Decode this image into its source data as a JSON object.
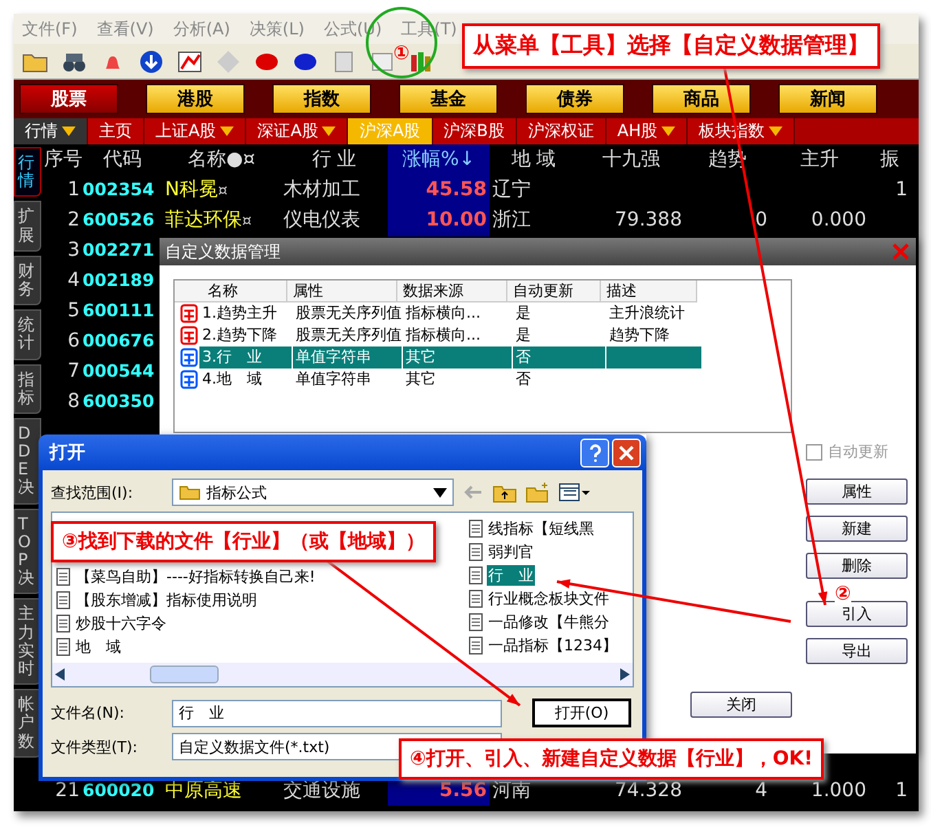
{
  "menu": [
    "文件(F)",
    "查看(V)",
    "分析(A)",
    "决策(L)",
    "公式(U)",
    "工具(T)"
  ],
  "categories": [
    {
      "label": "股票",
      "selected": true
    },
    {
      "label": "港股",
      "selected": false
    },
    {
      "label": "指数",
      "selected": false
    },
    {
      "label": "基金",
      "selected": false
    },
    {
      "label": "债券",
      "selected": false
    },
    {
      "label": "商品",
      "selected": false
    },
    {
      "label": "新闻",
      "selected": false
    }
  ],
  "tabs": [
    {
      "label": "行情",
      "kind": "menu",
      "selected": false,
      "dropdown": true
    },
    {
      "label": "主页",
      "kind": "tab",
      "selected": false,
      "dropdown": false
    },
    {
      "label": "上证A股",
      "kind": "tab",
      "selected": false,
      "dropdown": true
    },
    {
      "label": "深证A股",
      "kind": "tab",
      "selected": false,
      "dropdown": true
    },
    {
      "label": "沪深A股",
      "kind": "tab",
      "selected": true,
      "dropdown": false
    },
    {
      "label": "沪深B股",
      "kind": "tab",
      "selected": false,
      "dropdown": false
    },
    {
      "label": "沪深权证",
      "kind": "tab",
      "selected": false,
      "dropdown": false
    },
    {
      "label": "AH股",
      "kind": "tab",
      "selected": false,
      "dropdown": true
    },
    {
      "label": "板块指数",
      "kind": "tab",
      "selected": false,
      "dropdown": true
    }
  ],
  "side_tabs": [
    {
      "label": "行情",
      "selected": true
    },
    {
      "label": "扩展",
      "selected": false
    },
    {
      "label": "财务",
      "selected": false
    },
    {
      "label": "统计",
      "selected": false
    },
    {
      "label": "指标",
      "selected": false
    },
    {
      "label": "DDE决",
      "selected": false
    },
    {
      "label": "TOP决",
      "selected": false
    },
    {
      "label": "主力实时",
      "selected": false
    },
    {
      "label": "帐户数",
      "selected": false
    }
  ],
  "table": {
    "columns": [
      "序号",
      "代码",
      "名称●¤",
      "行 业",
      "涨幅%↓",
      "地 域",
      "十九强",
      "趋势",
      "主升",
      "振"
    ],
    "rows": [
      {
        "seq": "1",
        "code": "002354",
        "name": "N科冕",
        "mark": "¤",
        "industry": "木材加工",
        "change": "45.58",
        "region": "辽宁",
        "amp": "1"
      },
      {
        "seq": "2",
        "code": "600526",
        "name": "菲达环保",
        "mark": "¤",
        "industry": "仪电仪表",
        "change": "10.00",
        "region": "浙江",
        "strong19": "79.388",
        "trend": "0",
        "main": "0.000"
      },
      {
        "seq": "3",
        "code": "002271"
      },
      {
        "seq": "4",
        "code": "002189"
      },
      {
        "seq": "5",
        "code": "600111"
      },
      {
        "seq": "6",
        "code": "000676"
      },
      {
        "seq": "7",
        "code": "000544"
      },
      {
        "seq": "8",
        "code": "600350"
      }
    ],
    "last_row": {
      "seq": "21",
      "code": "600020",
      "name": "中原高速",
      "industry": "交通设施",
      "change": "5.56",
      "region": "河南",
      "strong19": "74.328",
      "trend": "4",
      "main": "1.000",
      "amp": "1"
    }
  },
  "data_manager": {
    "title": "自定义数据管理",
    "columns": [
      "名称",
      "属性",
      "数据来源",
      "自动更新",
      "描述"
    ],
    "rows": [
      {
        "kind": "sequence",
        "name": "1.趋势主升",
        "property": "股票无关序列值",
        "source": "指标横向...",
        "auto": "是",
        "description": "主升浪统计",
        "selected": false
      },
      {
        "kind": "sequence",
        "name": "2.趋势下降",
        "property": "股票无关序列值",
        "source": "指标横向...",
        "auto": "是",
        "description": "趋势下降",
        "selected": false
      },
      {
        "kind": "string",
        "name": "3.行　业",
        "property": "单值字符串",
        "source": "其它",
        "auto": "否",
        "selected": true
      },
      {
        "kind": "string",
        "name": "4.地　域",
        "property": "单值字符串",
        "source": "其它",
        "auto": "否",
        "selected": false
      }
    ],
    "auto_update": {
      "label": "自动更新",
      "checked": false
    },
    "buttons": [
      "属性",
      "新建",
      "删除",
      "引入",
      "导出"
    ],
    "close_button": "关闭"
  },
  "open_dialog": {
    "title": "打开",
    "look_in_label": "查找范围(I):",
    "look_in": "指标公式",
    "files_left": [
      {
        "name": "【菜鸟自助】----好指标转换自己来!",
        "selected": false
      },
      {
        "name": "【股东增减】指标使用说明",
        "selected": false
      },
      {
        "name": "炒股十六字令",
        "selected": false
      },
      {
        "name": "地　域",
        "selected": false
      }
    ],
    "files_right": [
      {
        "name": "线指标【短线黑",
        "selected": false
      },
      {
        "name": "弱判官",
        "selected": false
      },
      {
        "name": "行　业",
        "selected": true
      },
      {
        "name": "行业概念板块文件",
        "selected": false
      },
      {
        "name": "一品修改【牛熊分",
        "selected": false
      },
      {
        "name": "一品指标【1234】",
        "selected": false
      }
    ],
    "file_name_label": "文件名(N):",
    "file_name": "行　业",
    "file_type_label": "文件类型(T):",
    "file_type": "自定义数据文件(*.txt)",
    "open_button": "打开(O)"
  },
  "annotations": {
    "step1_marker": "①",
    "menu_callout": "从菜单【工具】选择【自定义数据管理】",
    "step2_marker": "②",
    "step3_callout": "③找到下载的文件【行业】（或【地域】）",
    "step4_callout": "④打开、引入、新建自定义数据【行业】，OK!"
  }
}
